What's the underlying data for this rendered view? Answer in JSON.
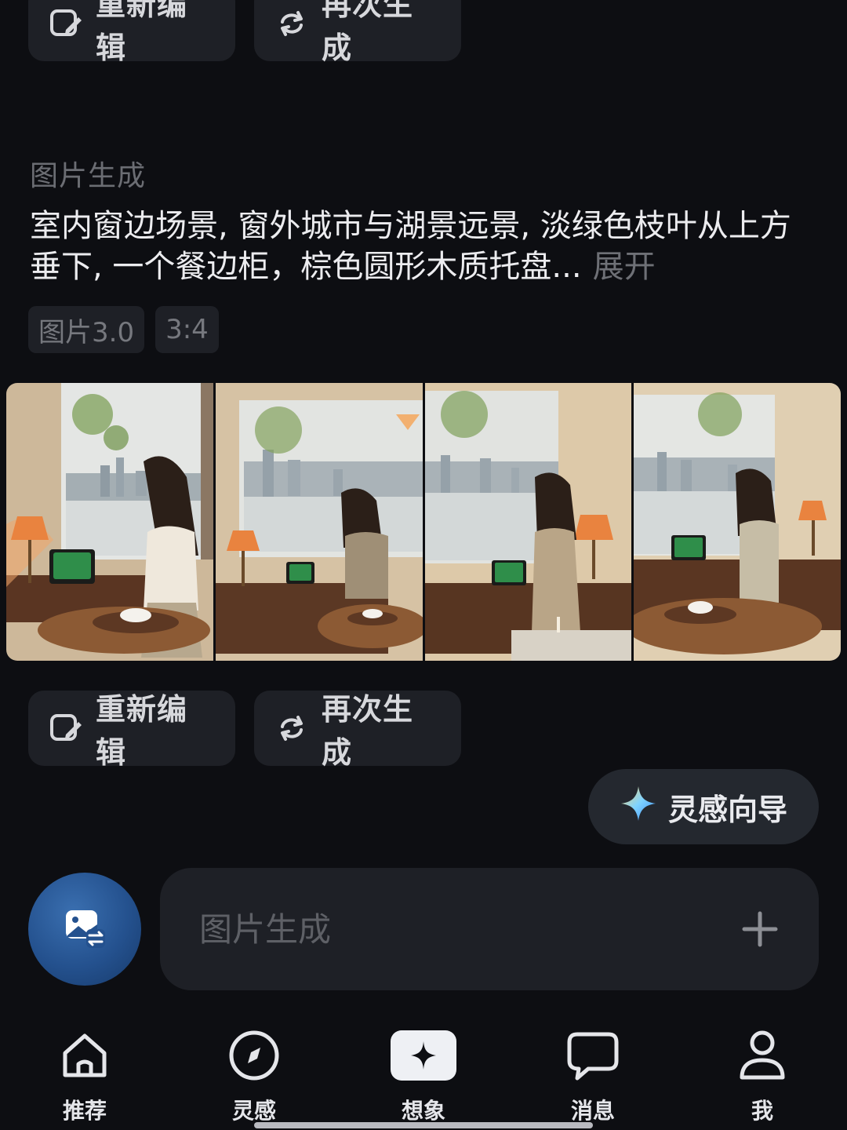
{
  "top_actions": {
    "edit_label": "重新编辑",
    "regen_label": "再次生成"
  },
  "section": {
    "label": "图片生成"
  },
  "prompt": {
    "text": "室内窗边场景, 窗外城市与湖景远景, 淡绿色枝叶从上方垂下, 一个餐边柜，棕色圆形木质托盘...",
    "expand_label": "展开"
  },
  "tags": [
    "图片3.0",
    "3:4"
  ],
  "gallery": {
    "images": [
      {
        "name": "generated-image-1"
      },
      {
        "name": "generated-image-2"
      },
      {
        "name": "generated-image-3"
      },
      {
        "name": "generated-image-4"
      }
    ]
  },
  "mid_actions": {
    "edit_label": "重新编辑",
    "regen_label": "再次生成"
  },
  "inspire": {
    "label": "灵感向导",
    "icon": "sparkle-icon"
  },
  "composer": {
    "placeholder": "图片生成",
    "mode_icon": "image-swap-icon",
    "plus_icon": "plus-icon"
  },
  "tabbar": {
    "tabs": [
      {
        "label": "推荐",
        "icon": "home-icon"
      },
      {
        "label": "灵感",
        "icon": "compass-icon"
      },
      {
        "label": "想象",
        "icon": "sparkle-icon"
      },
      {
        "label": "消息",
        "icon": "chat-icon"
      },
      {
        "label": "我",
        "icon": "person-icon"
      }
    ]
  },
  "colors": {
    "background": "#0d0e12",
    "surface": "#1e2026",
    "accent": "#24518e"
  }
}
